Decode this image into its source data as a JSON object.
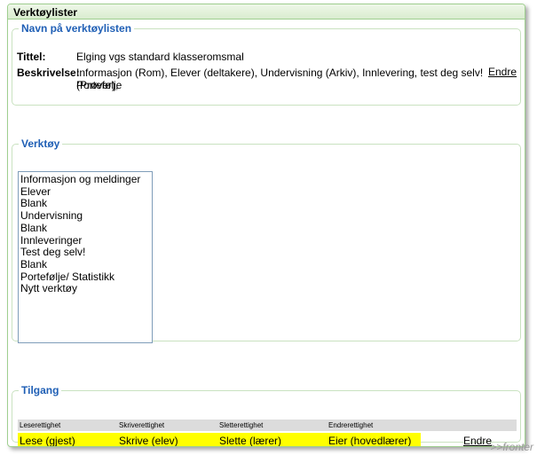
{
  "window": {
    "title": "Verktøylister"
  },
  "name_section": {
    "legend": "Navn på verktøylisten",
    "title_label": "Tittel:",
    "title_value": "Elging vgs standard klasseromsmal",
    "description_label": "Beskrivelse:",
    "description_line1": "Informasjon (Rom), Elever (deltakere), Undervisning (Arkiv), Innlevering, test deg selv! (Prøver),",
    "description_line2": "Portefølje",
    "edit_link": "Endre"
  },
  "tools_section": {
    "legend": "Verktøy",
    "items": [
      "Informasjon og meldinger",
      "Elever",
      "Blank",
      "Undervisning",
      "Blank",
      "Innleveringer",
      "Test deg selv!",
      "Blank",
      "Portefølje/ Statistikk",
      "Nytt verktøy"
    ]
  },
  "access_section": {
    "legend": "Tilgang",
    "headers": [
      "Leserettighet",
      "Skriverettighet",
      "Sletterettighet",
      "Endrerettighet"
    ],
    "values": [
      "Lese (gjest)",
      "Skrive (elev)",
      "Slette (lærer)",
      "Eier (hovedlærer)"
    ],
    "edit_link": "Endre",
    "highlight_color": "#ffff00"
  },
  "watermark": ">>fronter"
}
